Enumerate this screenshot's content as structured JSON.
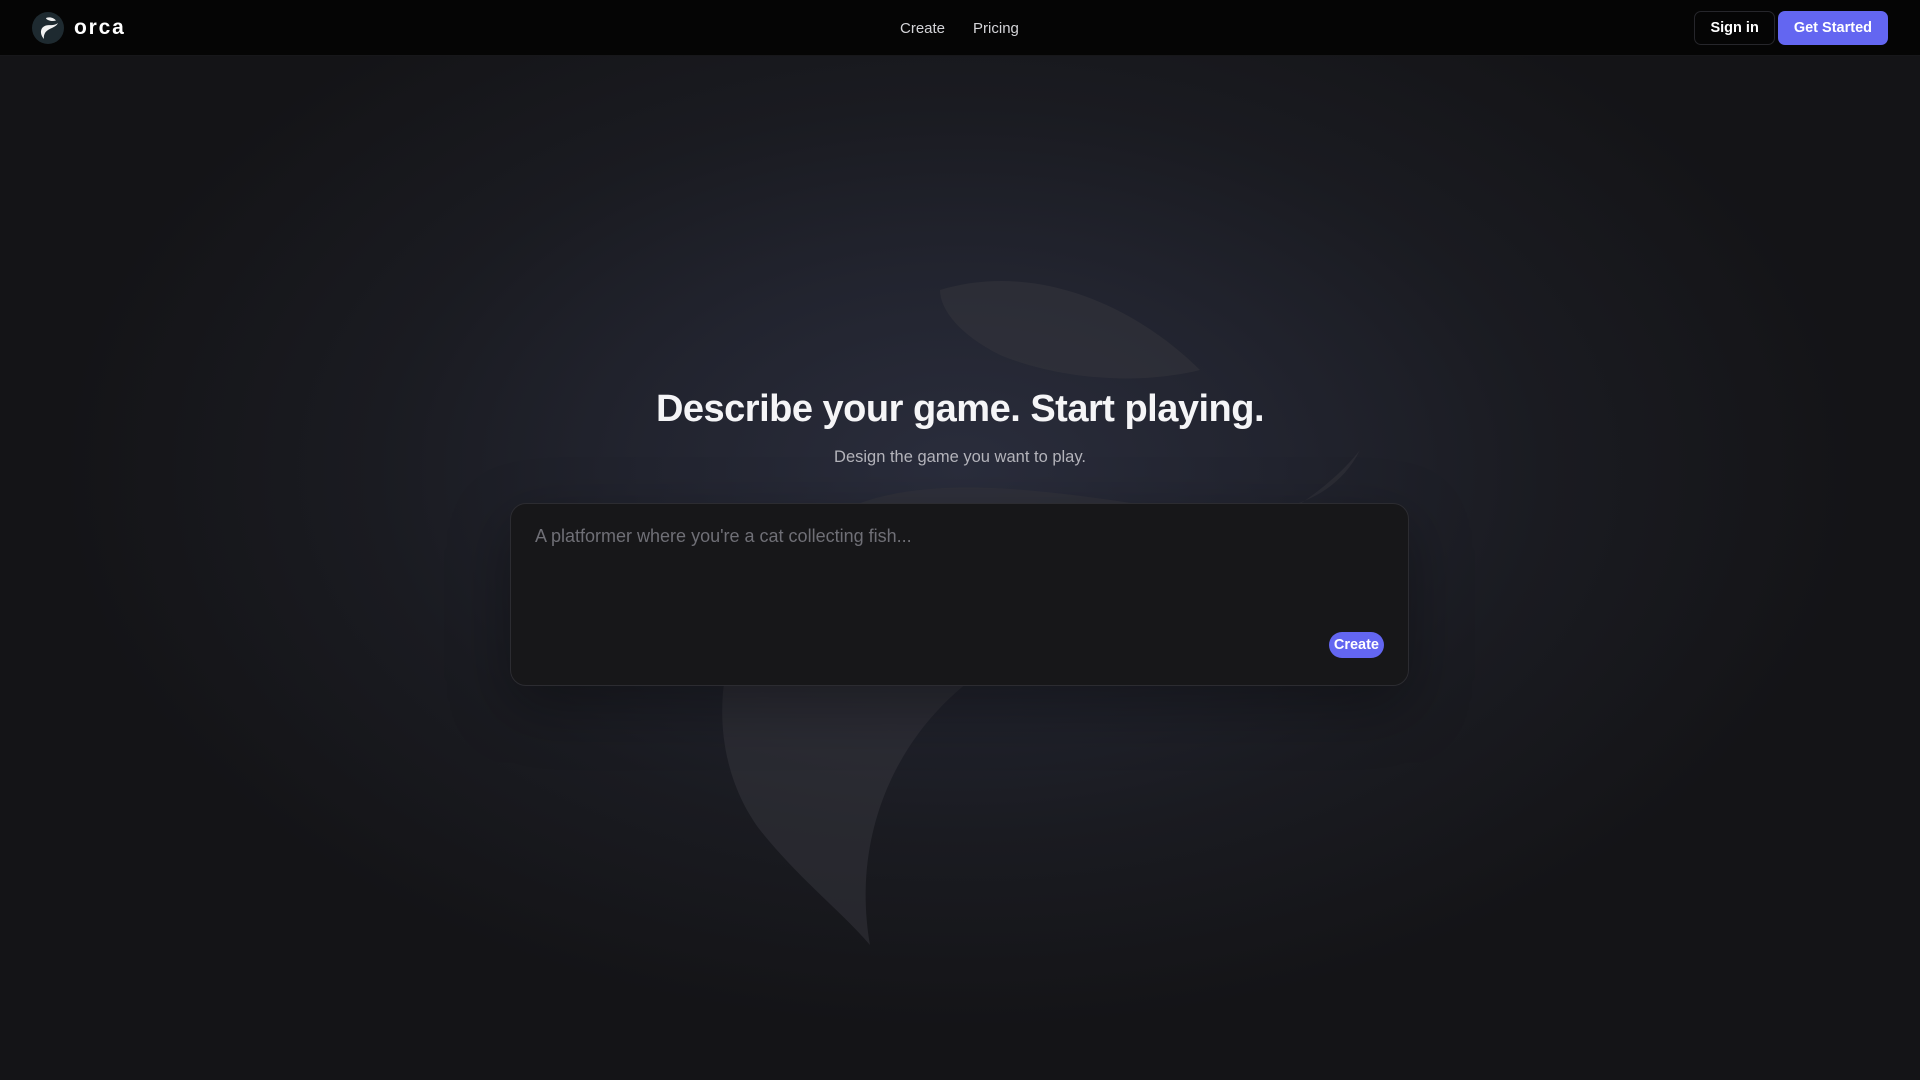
{
  "brand": {
    "name": "orca",
    "logo_icon": "orca-logo-icon"
  },
  "nav": {
    "links": [
      {
        "label": "Create"
      },
      {
        "label": "Pricing"
      }
    ]
  },
  "auth": {
    "sign_in_label": "Sign in",
    "get_started_label": "Get Started"
  },
  "hero": {
    "title": "Describe your game. Start playing.",
    "subtitle": "Design the game you want to play."
  },
  "prompt": {
    "placeholder": "A platformer where you're a cat collecting fish...",
    "value": "",
    "submit_label": "Create"
  },
  "colors": {
    "accent": "#6366f1",
    "topbar": "#050505",
    "background": "#1c1d24",
    "panel": "#171719"
  },
  "background_icon": "orca-watermark-icon"
}
